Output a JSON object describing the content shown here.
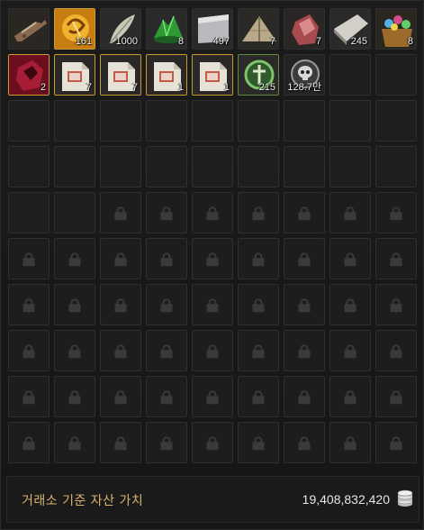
{
  "inventory": {
    "items": [
      {
        "icon": "flintlock-gun-icon",
        "count": "",
        "border": "none"
      },
      {
        "icon": "gold-rune-icon",
        "count": "161",
        "border": "gold"
      },
      {
        "icon": "feather-icon",
        "count": "1000",
        "border": "none"
      },
      {
        "icon": "green-crystal-icon",
        "count": "8",
        "border": "none"
      },
      {
        "icon": "metal-plate-icon",
        "count": "497",
        "border": "none"
      },
      {
        "icon": "tent-cloth-icon",
        "count": "7",
        "border": "none"
      },
      {
        "icon": "red-ore-icon",
        "count": "7",
        "border": "none"
      },
      {
        "icon": "stone-slab-icon",
        "count": "245",
        "border": "none"
      },
      {
        "icon": "gem-basket-icon",
        "count": "8",
        "border": "none"
      },
      {
        "icon": "crimson-box-icon",
        "count": "2",
        "border": "gold"
      },
      {
        "icon": "scroll-document-icon",
        "count": "7",
        "border": "gold"
      },
      {
        "icon": "scroll-document-icon",
        "count": "7",
        "border": "gold"
      },
      {
        "icon": "scroll-document-icon",
        "count": "1",
        "border": "gold"
      },
      {
        "icon": "scroll-document-icon",
        "count": "1",
        "border": "gold"
      },
      {
        "icon": "green-emblem-icon",
        "count": "215",
        "border": "green"
      },
      {
        "icon": "skull-coin-icon",
        "count": "128.7만",
        "border": "none"
      }
    ],
    "empty_slots": 22,
    "locked_slots": 52
  },
  "footer": {
    "label": "거래소 기준 자산 가치",
    "value": "19,408,832,420",
    "icon": "coin-stack-icon"
  },
  "colors": {
    "gold_border": "#c99a32",
    "green_border": "#5e8b3a",
    "footer_label": "#d9b36c"
  }
}
